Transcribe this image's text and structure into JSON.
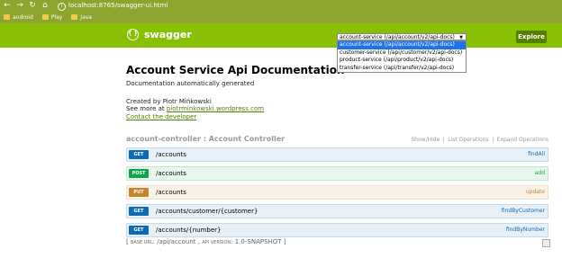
{
  "browser": {
    "url": "localhost:8765/swagger-ui.html",
    "bookmarks": [
      "android",
      "Play",
      "Java"
    ]
  },
  "header": {
    "logo_text": "swagger",
    "select_value": "account-service (/api/account/v2/api-docs)",
    "options": [
      "account-service (/api/account/v2/api-docs)",
      "customer-service (/api/customer/v2/api-docs)",
      "product-service (/api/product/v2/api-docs)",
      "transfer-service (/api/transfer/v2/api-docs)"
    ],
    "explore_label": "Explore"
  },
  "info": {
    "title": "Account Service Api Documentation",
    "description": "Documentation automatically generated",
    "created_by": "Created by Piotr Mińkowski",
    "see_more_prefix": "See more at ",
    "see_more_link": "piotrminkowski.wordpress.com",
    "contact": "Contact the developer"
  },
  "resource": {
    "title": "account-controller : Account Controller",
    "links": [
      "Show/Hide",
      "List Operations",
      "Expand Operations"
    ],
    "operations": [
      {
        "method": "GET",
        "path": "/accounts",
        "nickname": "findAll"
      },
      {
        "method": "POST",
        "path": "/accounts",
        "nickname": "add"
      },
      {
        "method": "PUT",
        "path": "/accounts",
        "nickname": "update"
      },
      {
        "method": "GET",
        "path": "/accounts/customer/{customer}",
        "nickname": "findByCustomer"
      },
      {
        "method": "GET",
        "path": "/accounts/{number}",
        "nickname": "findByNumber"
      }
    ]
  },
  "footer": {
    "base_url_label": "BASE URL",
    "base_url": "/api/account",
    "api_version_label": "API VERSION",
    "api_version": "1.0-SNAPSHOT"
  }
}
